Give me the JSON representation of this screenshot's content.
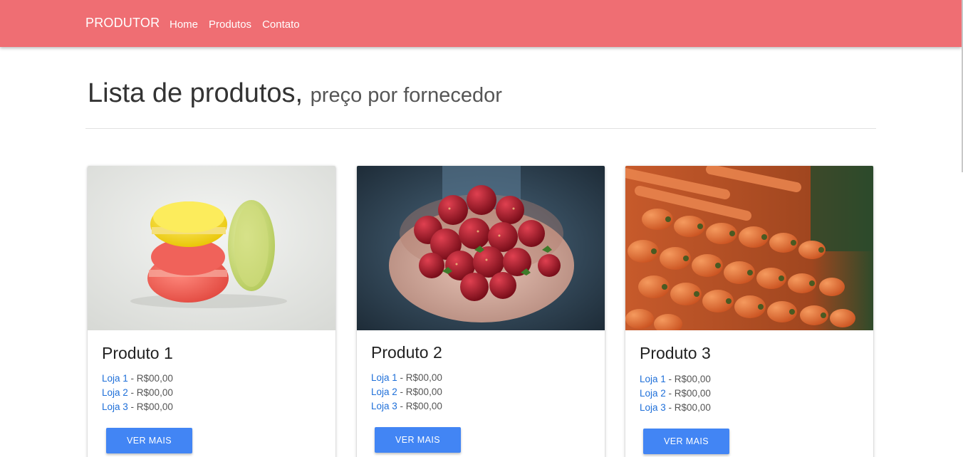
{
  "navbar": {
    "brand": "PRODUTOR",
    "links": [
      "Home",
      "Produtos",
      "Contato"
    ]
  },
  "header": {
    "title": "Lista de produtos,",
    "subtitle": "preço por fornecedor"
  },
  "products": [
    {
      "title": "Produto 1",
      "image": "macarons",
      "stores": [
        {
          "name": "Loja 1",
          "price": "R$00,00"
        },
        {
          "name": "Loja 2",
          "price": "R$00,00"
        },
        {
          "name": "Loja 3",
          "price": "R$00,00"
        }
      ],
      "button": "VER MAIS"
    },
    {
      "title": "Produto 2",
      "image": "strawberries",
      "stores": [
        {
          "name": "Loja 1",
          "price": "R$00,00"
        },
        {
          "name": "Loja 2",
          "price": "R$00,00"
        },
        {
          "name": "Loja 3",
          "price": "R$00,00"
        }
      ],
      "button": "VER MAIS"
    },
    {
      "title": "Produto 3",
      "image": "carrots",
      "stores": [
        {
          "name": "Loja 1",
          "price": "R$00,00"
        },
        {
          "name": "Loja 2",
          "price": "R$00,00"
        },
        {
          "name": "Loja 3",
          "price": "R$00,00"
        }
      ],
      "button": "VER MAIS"
    }
  ],
  "colors": {
    "navbar": "#ef6e73",
    "button": "#4285f4",
    "link": "#1e6fd9"
  }
}
